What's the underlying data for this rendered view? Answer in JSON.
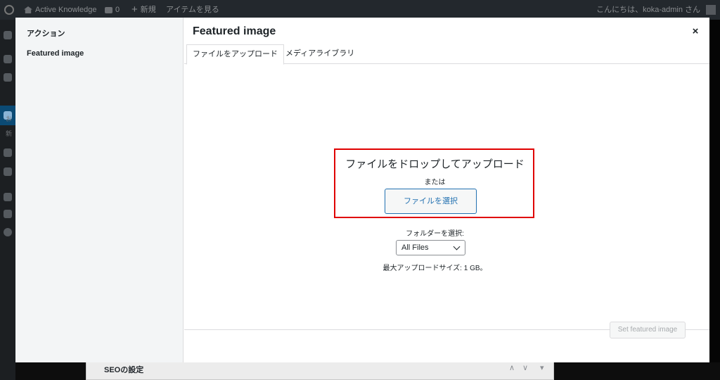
{
  "admin_bar": {
    "site_name": "Active Knowledge",
    "comments_count": "0",
    "new_label": "新規",
    "view_items": "アイテムを見る",
    "howdy": "こんにちは、koka-admin さん"
  },
  "sidebar_partial": {
    "label_1": "お",
    "label_2": "新"
  },
  "background": {
    "seo_label": "SEOの設定"
  },
  "modal": {
    "menu": {
      "heading": "アクション",
      "item": "Featured image"
    },
    "title": "Featured image",
    "close_icon": "×",
    "tabs": [
      {
        "label": "ファイルをアップロード",
        "active": true
      },
      {
        "label": "メディアライブラリ",
        "active": false
      }
    ],
    "uploader": {
      "drop_text": "ファイルをドロップしてアップロード",
      "or_text": "または",
      "select_button": "ファイルを選択",
      "folder_label": "フォルダーを選択:",
      "folder_value": "All Files",
      "max_size": "最大アップロードサイズ: 1 GB。"
    },
    "footer": {
      "set_button": "Set featured image"
    }
  },
  "colors": {
    "highlight_box": "#e00000",
    "accent": "#2271b1",
    "admin_bar_bg": "#23282d"
  }
}
